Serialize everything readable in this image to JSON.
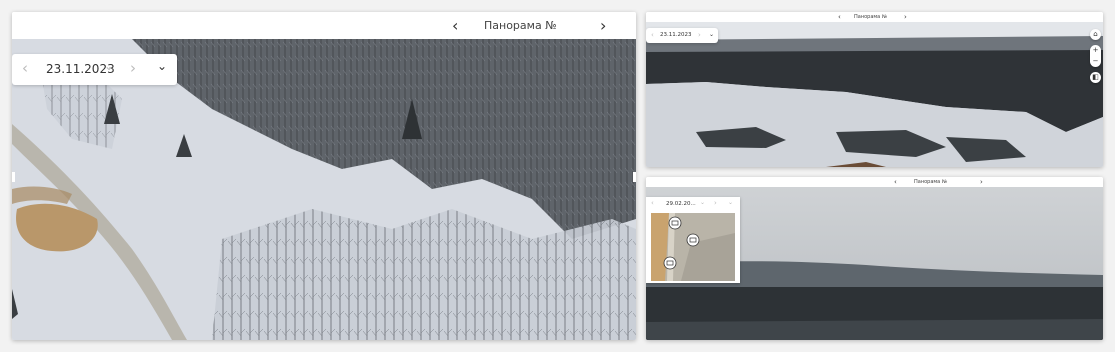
{
  "main": {
    "title": "Панорама №",
    "date": "23.11.2023"
  },
  "right_top": {
    "title": "Панорама №",
    "date": "23.11.2023",
    "zoom_in": "+",
    "zoom_out": "−"
  },
  "right_bottom": {
    "title": "Панорама №",
    "date": "29.02.20..."
  },
  "icons": {
    "prev": "‹",
    "next": "›",
    "dropdown": "⌄",
    "home": "⌂",
    "layers": "◧"
  },
  "colors": {
    "snow": "#d9dde3",
    "forest": "#2e3235",
    "sky": "#c8ccd0",
    "sand": "#c8a77a"
  }
}
